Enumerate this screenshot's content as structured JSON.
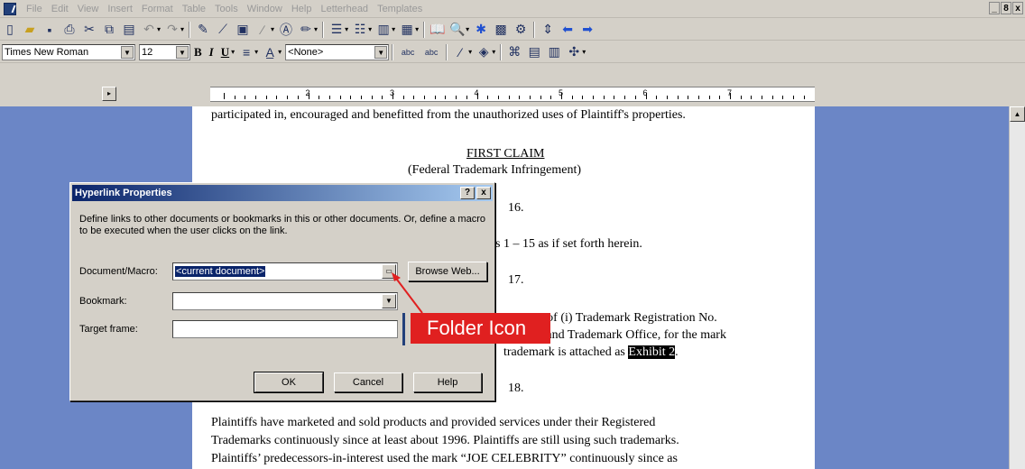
{
  "menubar": {
    "items": [
      "File",
      "Edit",
      "View",
      "Insert",
      "Format",
      "Table",
      "Tools",
      "Window",
      "Help",
      "Letterhead",
      "Templates"
    ],
    "window_controls": [
      "_",
      "8",
      "x"
    ]
  },
  "format_bar": {
    "font": "Times New Roman",
    "size": "12",
    "bold": "B",
    "italic": "I",
    "underline": "U",
    "style": "<None>",
    "abc1": "abc",
    "abc2": "abc"
  },
  "ruler": {
    "numbers": [
      "1",
      "2",
      "3",
      "4",
      "5",
      "6",
      "7"
    ]
  },
  "document": {
    "line1": "participated in, encouraged and benefitted from the unauthorized uses of Plaintiff's properties.",
    "claim_title": "FIRST CLAIM",
    "claim_subtitle": "(Federal Trademark Infringement)",
    "para16": "16.",
    "line_incorp": "s 1 – 15 as if set forth herein.",
    "para17": "17.",
    "line_reg": "r of (i) Trademark Registration No.",
    "line_office": "t and Trademark Office, for the mark",
    "line_attached_pre": "trademark is attached as ",
    "exhibit": "Exhibit 2",
    "line_attached_post": ".",
    "para18": "18.",
    "p1": "Plaintiffs have marketed and sold products and provided services under their Registered",
    "p2": "Trademarks continuously since at least about 1996.  Plaintiffs are still using such trademarks.",
    "p3": "Plaintiffs’ predecessors-in-interest used the mark “JOE CELEBRITY” continuously since as"
  },
  "dialog": {
    "title": "Hyperlink Properties",
    "help_btn": "?",
    "close_btn": "x",
    "description": "Define links to other documents or bookmarks in this or other documents. Or, define a macro to be executed when the user clicks on the link.",
    "document_label": "Document/Macro:",
    "document_value": "<current document>",
    "browse_label": "Browse Web...",
    "bookmark_label": "Bookmark:",
    "bookmark_value": "",
    "target_label": "Target frame:",
    "target_value": "",
    "ok": "OK",
    "cancel": "Cancel",
    "help": "Help"
  },
  "annotation": {
    "label": "Folder Icon",
    "color": "#e02020"
  }
}
